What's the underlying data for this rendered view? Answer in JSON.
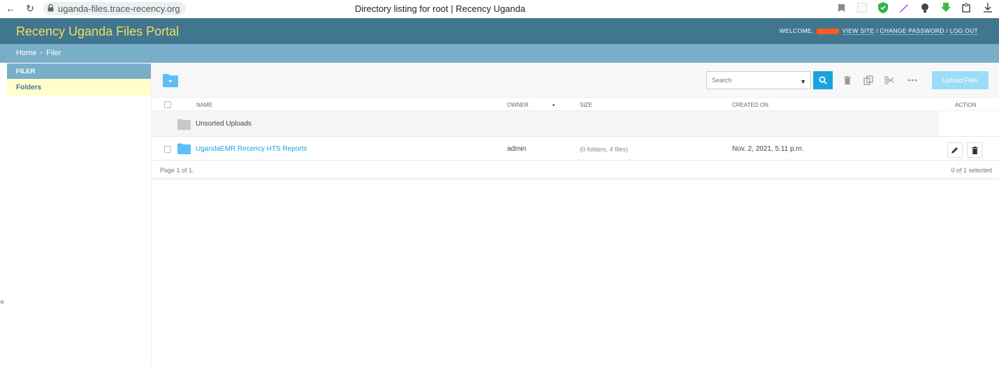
{
  "browser": {
    "url": "uganda-files.trace-recency.org",
    "tab_title": "Directory listing for root | Recency Uganda"
  },
  "header": {
    "portal_title": "Recency Uganda Files Portal",
    "welcome": "WELCOME,",
    "view_site": "VIEW SITE",
    "change_password": "CHANGE PASSWORD",
    "log_out": "LOG OUT",
    "divider": "/"
  },
  "breadcrumbs": {
    "home": "Home",
    "separator": "›",
    "current": "Filer"
  },
  "sidebar": {
    "section": "FILER",
    "item": "Folders",
    "collapse": "«"
  },
  "toolbar": {
    "search_placeholder": "Search",
    "upload_label": "Upload Files"
  },
  "table": {
    "columns": {
      "name": "NAME",
      "owner": "OWNER",
      "size": "SIZE",
      "created": "CREATED ON",
      "action": "ACTION"
    },
    "unsorted_label": "Unsorted Uploads",
    "rows": [
      {
        "name": "UgandaEMR Recency HTS Reports",
        "owner": "admin",
        "size": "(0 folders, 4 files)",
        "created": "Nov. 2, 2021, 5:11 p.m."
      }
    ]
  },
  "footer": {
    "pagination": "Page 1 of 1.",
    "selected": "0 of 1 selected"
  },
  "colors": {
    "header": "#417690",
    "breadcrumb": "#79aec8",
    "title": "#f5dd5d",
    "accent": "#1aa4de",
    "folder": "#5bc0f5"
  },
  "icons": [
    "back-icon",
    "reload-icon",
    "lock-icon",
    "bookmark-icon",
    "search-icon",
    "trash-icon",
    "copy-icon",
    "scissors-icon",
    "more-icon",
    "pencil-icon",
    "folder-icon"
  ]
}
